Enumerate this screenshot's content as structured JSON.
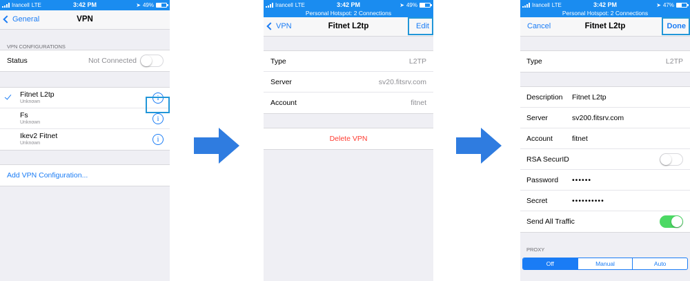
{
  "colors": {
    "accent": "#1a7cf5",
    "status_bar": "#1a8cf0",
    "toggle_on": "#4cd964",
    "destructive": "#ff3b30",
    "arrow": "#2f7ce0",
    "highlight": "#2196d8"
  },
  "status_bar": {
    "carrier": "Irancell",
    "network": "LTE",
    "time": "3:42 PM"
  },
  "hotspot_banner": "Personal Hotspot: 2 Connections",
  "screen1": {
    "battery": "49%",
    "battery_level": 0.49,
    "nav": {
      "back": "General",
      "title": "VPN"
    },
    "section_header": "VPN CONFIGURATIONS",
    "status": {
      "label": "Status",
      "value": "Not Connected",
      "toggle_on": false
    },
    "vpns": [
      {
        "name": "Fitnet L2tp",
        "status": "Unknown",
        "selected": true
      },
      {
        "name": "Fs",
        "status": "Unknown",
        "selected": false
      },
      {
        "name": "Ikev2 Fitnet",
        "status": "Unknown",
        "selected": false
      }
    ],
    "add_link": "Add VPN Configuration..."
  },
  "screen2": {
    "battery": "49%",
    "battery_level": 0.49,
    "nav": {
      "back": "VPN",
      "title": "Fitnet L2tp",
      "action": "Edit"
    },
    "rows": [
      {
        "label": "Type",
        "value": "L2TP"
      },
      {
        "label": "Server",
        "value": "sv20.fitsrv.com"
      },
      {
        "label": "Account",
        "value": "fitnet"
      }
    ],
    "delete": "Delete VPN"
  },
  "screen3": {
    "battery": "47%",
    "battery_level": 0.47,
    "nav": {
      "cancel": "Cancel",
      "title": "Fitnet L2tp",
      "action": "Done"
    },
    "type": {
      "label": "Type",
      "value": "L2TP"
    },
    "fields": {
      "description": {
        "label": "Description",
        "value": "Fitnet L2tp"
      },
      "server": {
        "label": "Server",
        "value": "sv200.fitsrv.com"
      },
      "account": {
        "label": "Account",
        "value": "fitnet"
      },
      "rsa": {
        "label": "RSA SecurID",
        "toggle_on": false
      },
      "password": {
        "label": "Password",
        "value": "••••••"
      },
      "secret": {
        "label": "Secret",
        "value": "••••••••••"
      },
      "send_all": {
        "label": "Send All Traffic",
        "toggle_on": true
      }
    },
    "proxy_header": "PROXY",
    "proxy_options": [
      "Off",
      "Manual",
      "Auto"
    ],
    "proxy_selected": "Off"
  }
}
